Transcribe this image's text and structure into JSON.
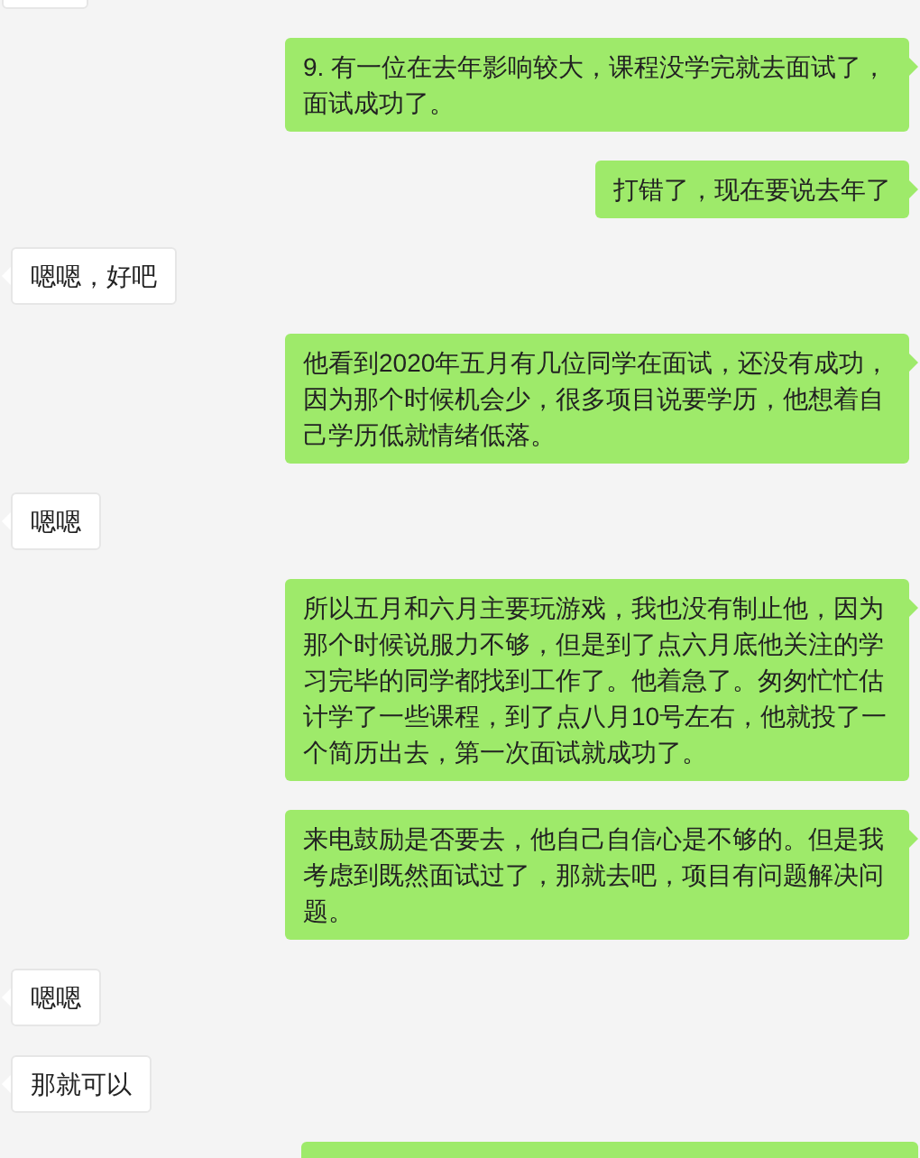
{
  "messages": [
    {
      "kind": "received"
    },
    {
      "kind": "sent",
      "text": "9. 有一位在去年影响较大，课程没学完就去面试了，面试成功了。"
    },
    {
      "kind": "sent",
      "text": "打错了，现在要说去年了"
    },
    {
      "kind": "received",
      "text": "嗯嗯，好吧"
    },
    {
      "kind": "sent",
      "text": "他看到2020年五月有几位同学在面试，还没有成功，因为那个时候机会少，很多项目说要学历，他想着自己学历低就情绪低落。"
    },
    {
      "kind": "received",
      "text": "嗯嗯"
    },
    {
      "kind": "sent",
      "text": "所以五月和六月主要玩游戏，我也没有制止他，因为那个时候说服力不够，但是到了点六月底他关注的学习完毕的同学都找到工作了。他着急了。匆匆忙忙估计学了一些课程，到了点八月10号左右，他就投了一个简历出去，第一次面试就成功了。"
    },
    {
      "kind": "sent",
      "text": "来电鼓励是否要去，他自己自信心是不够的。但是我考虑到既然面试过了，那就去吧，项目有问题解决问题。"
    },
    {
      "kind": "received",
      "text": "嗯嗯"
    },
    {
      "kind": "received",
      "text": "那就可以"
    },
    {
      "kind": "sent"
    }
  ]
}
